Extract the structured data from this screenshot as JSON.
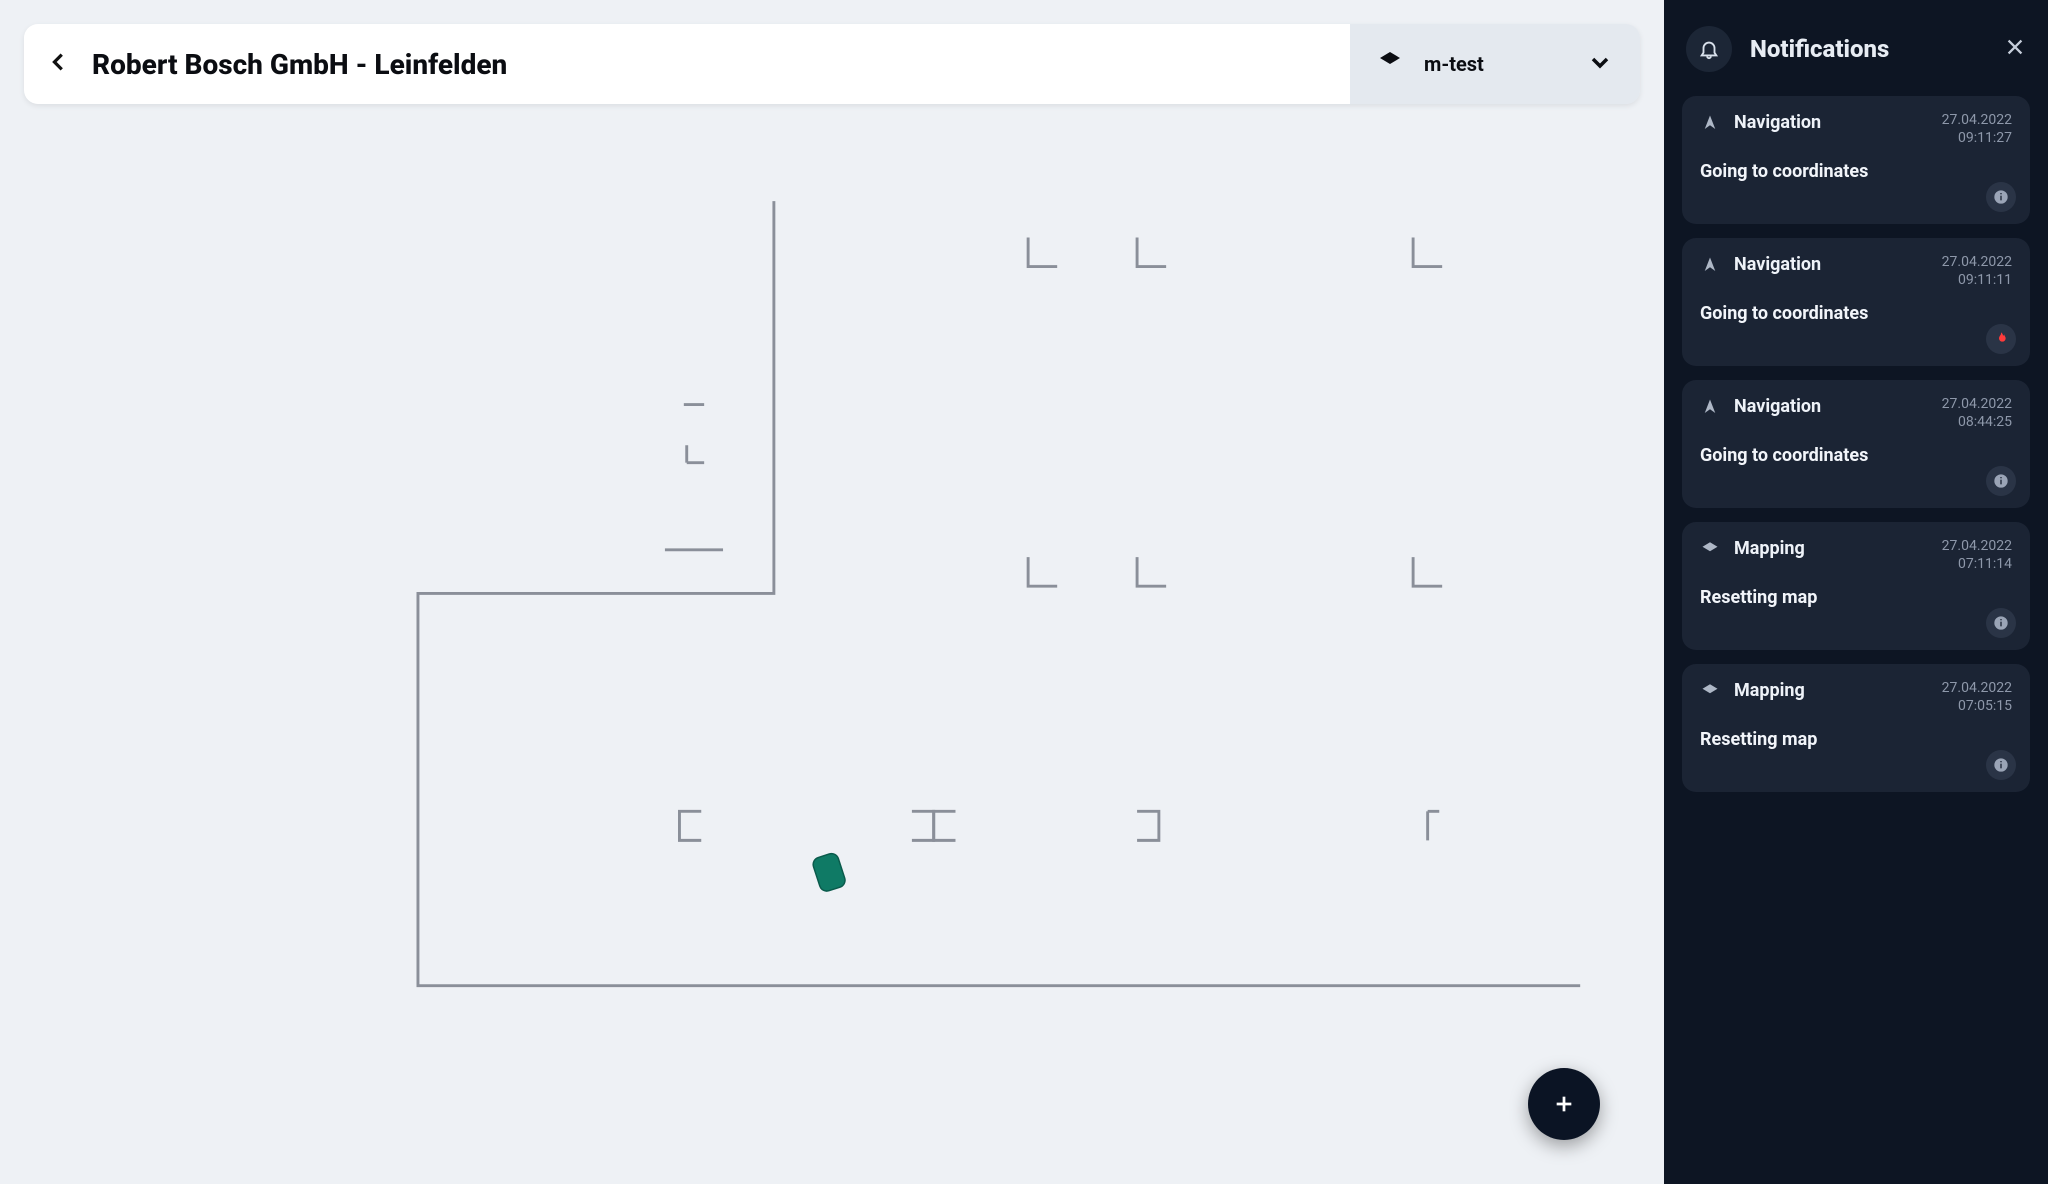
{
  "header": {
    "title": "Robert Bosch GmbH - Leinfelden",
    "layer_label": "m-test"
  },
  "side": {
    "title": "Notifications"
  },
  "notifications": [
    {
      "category": "Navigation",
      "icon": "nav",
      "date": "27.04.2022",
      "time": "09:11:27",
      "message": "Going to coordinates",
      "badge": "info"
    },
    {
      "category": "Navigation",
      "icon": "nav",
      "date": "27.04.2022",
      "time": "09:11:11",
      "message": "Going to coordinates",
      "badge": "fire"
    },
    {
      "category": "Navigation",
      "icon": "nav",
      "date": "27.04.2022",
      "time": "08:44:25",
      "message": "Going to coordinates",
      "badge": "info"
    },
    {
      "category": "Mapping",
      "icon": "map",
      "date": "27.04.2022",
      "time": "07:11:14",
      "message": "Resetting map",
      "badge": "info"
    },
    {
      "category": "Mapping",
      "icon": "map",
      "date": "27.04.2022",
      "time": "07:05:15",
      "message": "Resetting map",
      "badge": "info"
    }
  ]
}
